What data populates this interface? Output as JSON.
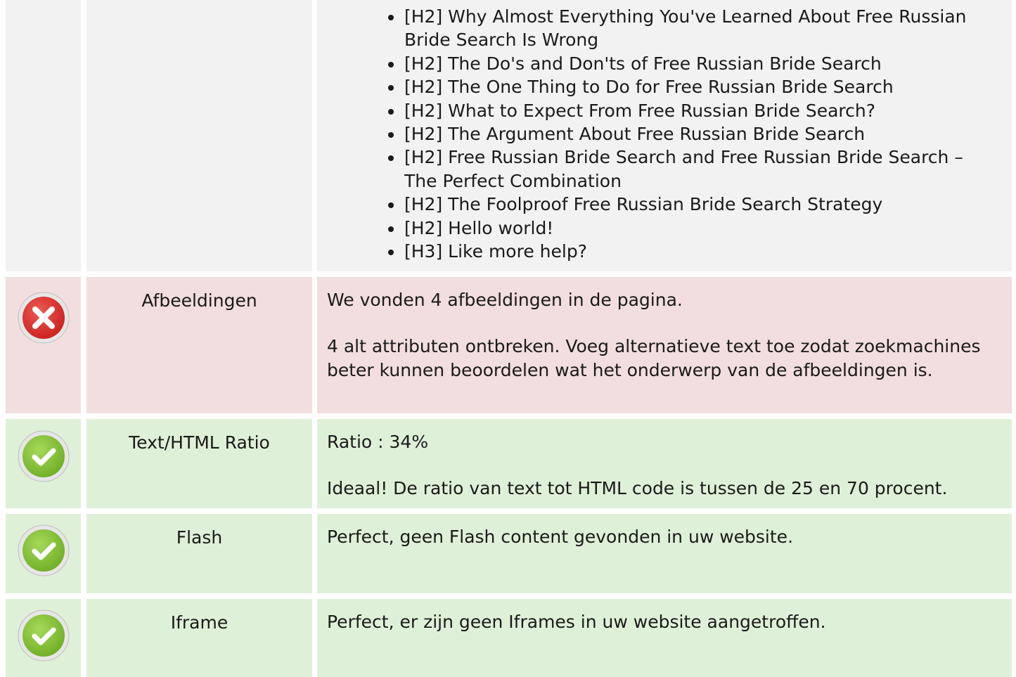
{
  "headings": {
    "items": [
      "[H2] Why Almost Everything You've Learned About Free Russian Bride Search Is Wrong",
      "[H2] The Do's and Don'ts of Free Russian Bride Search",
      "[H2] The One Thing to Do for Free Russian Bride Search",
      "[H2] What to Expect From Free Russian Bride Search?",
      "[H2] The Argument About Free Russian Bride Search",
      "[H2] Free Russian Bride Search and Free Russian Bride Search – The Perfect Combination",
      "[H2] The Foolproof Free Russian Bride Search Strategy",
      "[H2] Hello world!",
      "[H3] Like more help?"
    ]
  },
  "rows": {
    "images": {
      "status": "error",
      "icon": "error-x-icon",
      "label": "Afbeeldingen",
      "line1": "We vonden 4 afbeeldingen in de pagina.",
      "line2": "4 alt attributen ontbreken. Voeg alternatieve text toe zodat zoekmachines beter kunnen beoordelen wat het onderwerp van de afbeeldingen is."
    },
    "ratio": {
      "status": "ok",
      "icon": "check-icon",
      "label": "Text/HTML Ratio",
      "line1": "Ratio : 34%",
      "line2": "Ideaal! De ratio van text tot HTML code is tussen de 25 en 70 procent."
    },
    "flash": {
      "status": "ok",
      "icon": "check-icon",
      "label": "Flash",
      "line1": "Perfect, geen Flash content gevonden in uw website."
    },
    "iframe": {
      "status": "ok",
      "icon": "check-icon",
      "label": "Iframe",
      "line1": "Perfect, er zijn geen Iframes in uw website aangetroffen."
    }
  },
  "colors": {
    "error_bg": "#f2dede",
    "ok_bg": "#dff0d8",
    "neutral_bg": "#f2f2f2",
    "error_icon": "#d9322f",
    "ok_icon": "#8cc63e"
  }
}
